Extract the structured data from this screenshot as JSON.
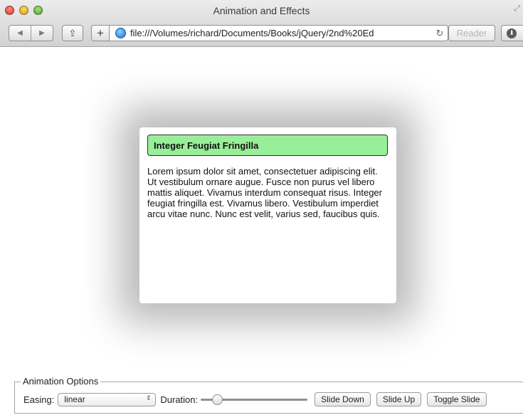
{
  "window": {
    "title": "Animation and Effects"
  },
  "toolbar": {
    "back_glyph": "◀",
    "forward_glyph": "▶",
    "share_glyph": "⇪",
    "new_tab_glyph": "+",
    "address_url": "file:///Volumes/richard/Documents/Books/jQuery/2nd%20Ed",
    "reload_glyph": "↻",
    "reader_label": "Reader",
    "download_glyph": "⬇"
  },
  "card": {
    "heading": "Integer Feugiat Fringilla",
    "body": "Lorem ipsum dolor sit amet, consectetuer adipiscing elit. Ut vestibulum ornare augue. Fusce non purus vel libero mattis aliquet. Vivamus interdum consequat risus. Integer feugiat fringilla est. Vivamus libero. Vestibulum imperdiet arcu vitae nunc. Nunc est velit, varius sed, faucibus quis.",
    "header_color": "#99ee99"
  },
  "options": {
    "legend": "Animation Options",
    "easing_label": "Easing:",
    "easing_value": "linear",
    "select_arrow_glyph": "⇕",
    "duration_label": "Duration:",
    "duration_level": 0.12,
    "slide_down_label": "Slide Down",
    "slide_up_label": "Slide Up",
    "toggle_slide_label": "Toggle Slide"
  }
}
